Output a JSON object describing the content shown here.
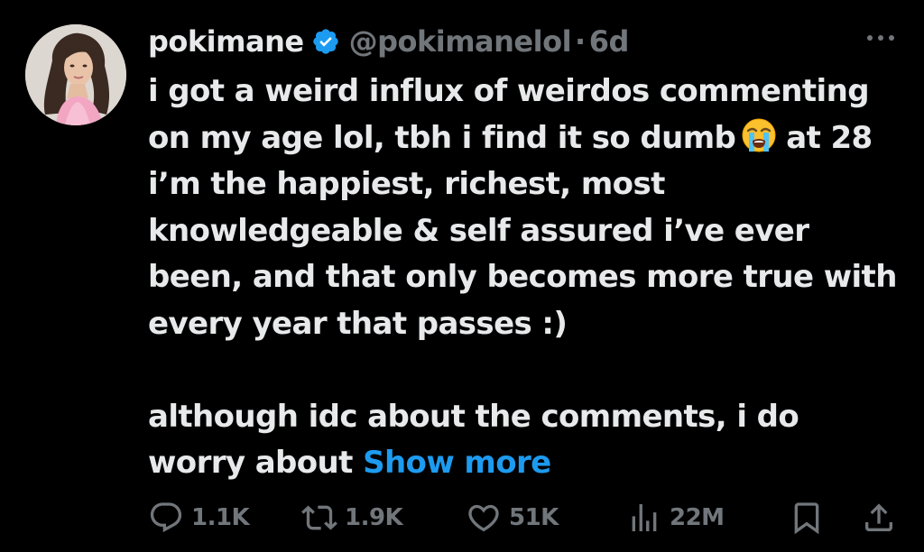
{
  "tweet": {
    "display_name": "pokimane",
    "handle": "@pokimanelol",
    "separator": "·",
    "time": "6d",
    "lines": [
      "i got a weird influx of weirdos commenting",
      "on my age lol, tbh i find it so dumb",
      "at 28",
      "i’m the happiest, richest, most",
      "knowledgeable & self assured i’ve ever",
      "been, and that only becomes more true with",
      "every year that passes :)",
      "although idc about the comments, i do",
      "worry about"
    ],
    "show_more": "Show more",
    "emoji": "loudly-crying-face-icon"
  },
  "actions": {
    "replies": "1.1K",
    "reposts": "1.9K",
    "likes": "51K",
    "views": "22M"
  },
  "colors": {
    "background": "#000000",
    "text": "#e7e9ea",
    "muted": "#71767b",
    "accent": "#1d9bf0"
  }
}
